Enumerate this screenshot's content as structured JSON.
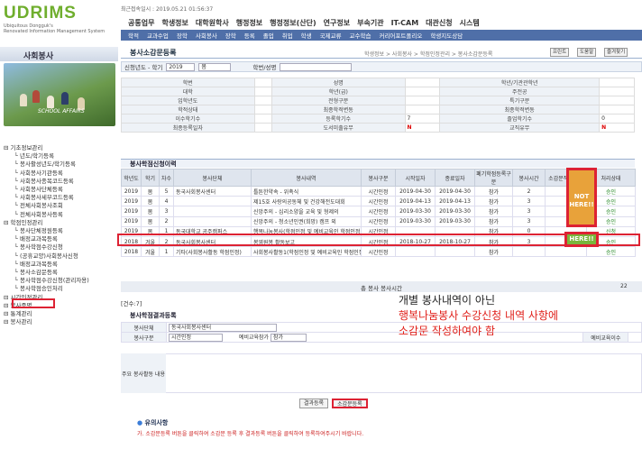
{
  "header": {
    "logo": "UDRIMS",
    "logo_sub1": "Ubiquitous Dongguk's",
    "logo_sub2": "Renovated Information Management System",
    "info": "최근접속일시 : 2019.05.21 01:56:37",
    "top_menu": [
      "공통업무",
      "학생정보",
      "대학원학사",
      "행정정보",
      "행정정보(산단)",
      "연구정보",
      "부속기관",
      "IT-CAM",
      "대관신청",
      "시스템"
    ],
    "sub_menu": [
      "학적",
      "교과수업",
      "장학",
      "사회봉사",
      "장학",
      "등록",
      "졸업",
      "취업",
      "학생",
      "국제교류",
      "교수학습",
      "커리어포트폴리오",
      "학생지도상담"
    ]
  },
  "sidebar": {
    "title": "사회봉사",
    "caption": "SCHOOL AFFAIRS",
    "tree": [
      {
        "t": "기초정보관리",
        "l": 1
      },
      {
        "t": "년도/학기등록",
        "l": 2
      },
      {
        "t": "봉사활성년도/학기등록",
        "l": 2
      },
      {
        "t": "사회봉사기관등록",
        "l": 2
      },
      {
        "t": "사회봉사종목코드등록",
        "l": 2
      },
      {
        "t": "사회봉사단체등록",
        "l": 2
      },
      {
        "t": "사회봉사세부코드등록",
        "l": 2
      },
      {
        "t": "전체사회봉사조회",
        "l": 2
      },
      {
        "t": "전체사회봉사등록",
        "l": 2
      },
      {
        "t": "학점인정관리",
        "l": 1
      },
      {
        "t": "봉사단체정원등록",
        "l": 2
      },
      {
        "t": "배정교과목등록",
        "l": 2
      },
      {
        "t": "봉사학점수강신청",
        "l": 2
      },
      {
        "t": "(공휴교양)사회봉사신청",
        "l": 2
      },
      {
        "t": "배정교과목등록",
        "l": 2
      },
      {
        "t": "봉사소감문등록",
        "l": 2
      },
      {
        "t": "봉사학점수강신청(관리자용)",
        "l": 2
      },
      {
        "t": "봉사학점승인처리",
        "l": 2
      },
      {
        "t": "시간인정관리",
        "l": 1
      },
      {
        "t": "봉사증명",
        "l": 1
      },
      {
        "t": "통계관리",
        "l": 1
      },
      {
        "t": "봉사관리",
        "l": 1
      }
    ]
  },
  "main": {
    "title": "봉사소감문등록",
    "breadcrumb": "학생정보 > 사회봉사 > 학점인정관리 > 봉사소감문등록",
    "btn_print": "프린트",
    "btn_help": "도움말",
    "btn_fav": "즐겨찾기",
    "filter": {
      "label_year": "신청년도 - 학기",
      "year": "2019",
      "term": "봄",
      "label_id": "학번/성명"
    },
    "info_rows": [
      [
        "학번",
        "",
        "성명",
        "",
        "학년/기관관학년",
        ""
      ],
      [
        "대학",
        "",
        "학년(급)",
        "",
        "주전공",
        ""
      ],
      [
        "입학년도",
        "",
        "전형구분",
        "",
        "특기구분",
        ""
      ],
      [
        "학적상태",
        "",
        "최종학적변동",
        "",
        "최종학적변동",
        ""
      ],
      [
        "이수학기수",
        "",
        "등록학기수",
        "7",
        "졸업학기수",
        "0"
      ],
      [
        "최종등록일자",
        "",
        "도서미출유무",
        "N",
        "교직유무",
        "N"
      ]
    ],
    "info_extra": [
      "연락처",
      "학위과정"
    ],
    "section1": "봉사학점신청이력",
    "hist_headers": [
      "학년도",
      "학기",
      "차수",
      "봉사단체",
      "봉사내역",
      "봉사구분",
      "시작일자",
      "종료일자",
      "폐기학점등록구분",
      "봉사시간",
      "소감문작성유무",
      "처리상태"
    ],
    "hist_rows": [
      [
        "2019",
        "봄",
        "5",
        "동국사회봉사센터",
        "틀튼한약속 - 위촉식",
        "시간인정",
        "2019-04-30",
        "2019-04-30",
        "참가",
        "2",
        "",
        "승인"
      ],
      [
        "2019",
        "봄",
        "4",
        "",
        "제15호 사랑의공동체 및 건강해전도대회",
        "시간인정",
        "2019-04-13",
        "2019-04-13",
        "참가",
        "3",
        "",
        "승인"
      ],
      [
        "2019",
        "봄",
        "3",
        "",
        "신앙주의 - 심리소양을 교육 및 형제의",
        "시간인정",
        "2019-03-30",
        "2019-03-30",
        "참가",
        "3",
        "",
        "승인"
      ],
      [
        "2019",
        "봄",
        "2",
        "",
        "신앙주의 - 청소년인권(희망) 캠프 외",
        "시간인정",
        "2019-03-30",
        "2019-03-30",
        "참가",
        "3",
        "",
        "승인"
      ],
      [
        "2019",
        "봄",
        "1",
        "동국대학교 공주캠퍼스",
        "행복나눔봉사(학점인정 및 예비교육인 학점인정",
        "시간인정",
        "",
        "",
        "참가",
        "0",
        "",
        "신청"
      ],
      [
        "2018",
        "겨울",
        "2",
        "동국사회봉사센터",
        "봉영원봉 활동보고",
        "시간인정",
        "2018-10-27",
        "2018-10-27",
        "참가",
        "3",
        "",
        "승인"
      ],
      [
        "2018",
        "겨울",
        "1",
        "기타(사회봉사활동 학점인정)",
        "사회봉사활동1(학점인정 및 예비교육인 학점인정",
        "시간인정",
        "",
        "",
        "참가",
        "",
        "",
        "승인"
      ]
    ],
    "not_here": "NOT HERE!!",
    "here": "HERE!!",
    "total_label": "총 봉사 봉사시간",
    "total_value": "22",
    "count_label": "[건수:7]",
    "section2": "봉사학점결과등록",
    "form2": {
      "org_label": "봉사단체",
      "org_value": "동국사회봉사센터",
      "type_label": "봉사구분",
      "type_value": "시간인정",
      "edu_label": "예비교육참가",
      "edu_value": "참가",
      "right_label": "예비교육이수",
      "content_label": "주요 봉사활동 내용"
    },
    "annotation": {
      "line1": "개별 봉사내역이 아닌",
      "line2": "행복나눔봉사 수강신청 내역 사항에",
      "line3": "소감문 작성하여야 함"
    },
    "btn_view": "결과등록",
    "btn_write": "소감문등록",
    "notice_title": "유의사항",
    "notice_text": "가. 소감문등록 버튼을 클릭하여 소감문 등록 후 결과등록 버튼을 클릭하여 등록하여주시기 바랍니다."
  }
}
